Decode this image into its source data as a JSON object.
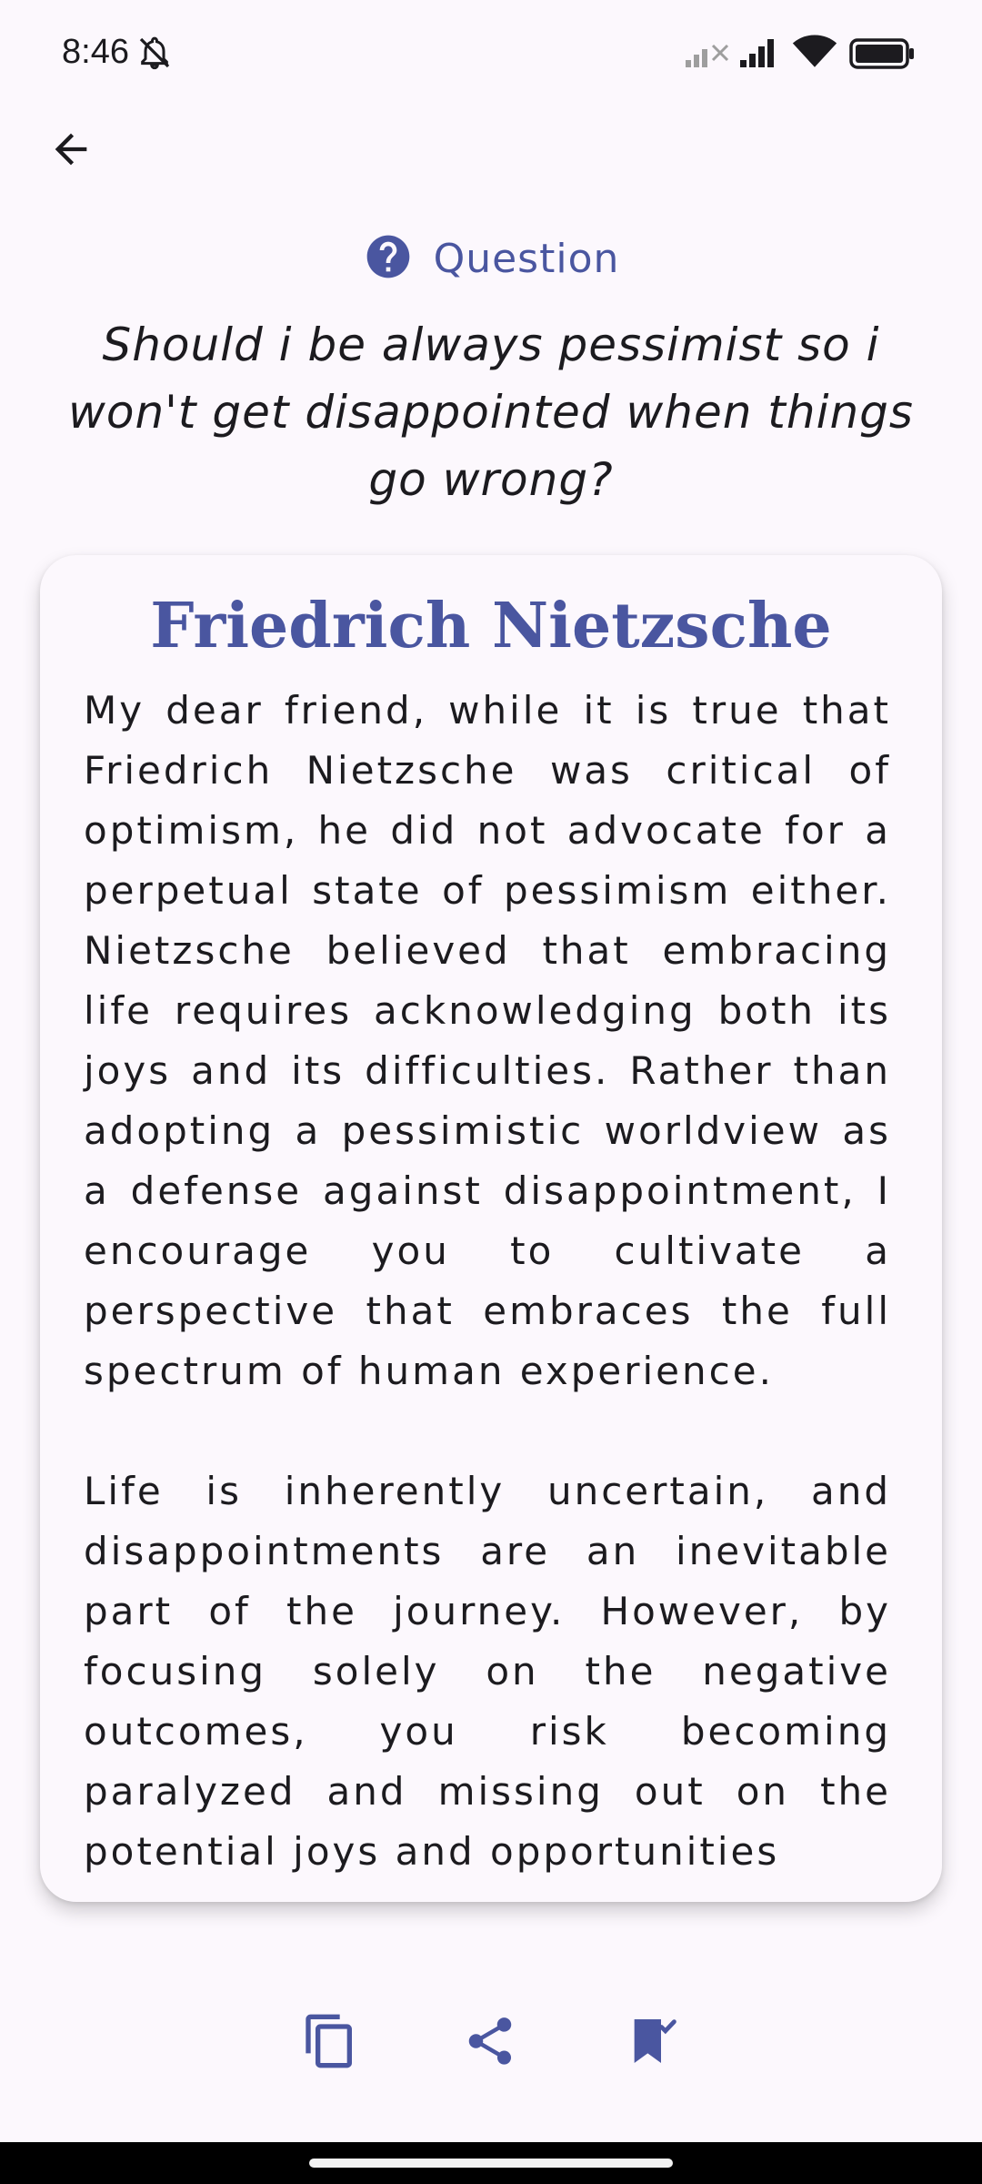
{
  "status_bar": {
    "time": "8:46"
  },
  "question": {
    "label": "Question",
    "text": "Should i be always pessimist so i won't get disappointed when things go wrong?"
  },
  "answer": {
    "author": "Friedrich Nietzsche",
    "paragraphs": [
      "My dear friend, while it is true that Friedrich Nietzsche was critical of optimism, he did not advocate for a perpetual state of pessimism either. Nietzsche believed that embracing life requires acknowledging both its joys and its difficulties. Rather than adopting a pessimistic worldview as a defense against disappointment, I encourage you to cultivate a perspective that embraces the full spectrum of human experience.",
      "Life is inherently uncertain, and disappointments are an inevitable part of the journey. However, by focusing solely on the negative outcomes, you risk becoming paralyzed and missing out on the potential joys and opportunities"
    ]
  },
  "icons": {
    "back": "arrow-back-icon",
    "question": "help-circle-icon",
    "copy": "copy-icon",
    "share": "share-icon",
    "bookmark": "bookmark-added-icon"
  },
  "colors": {
    "accent": "#4a56a0",
    "background": "#fcf8fd",
    "text": "#1c1b1f"
  }
}
